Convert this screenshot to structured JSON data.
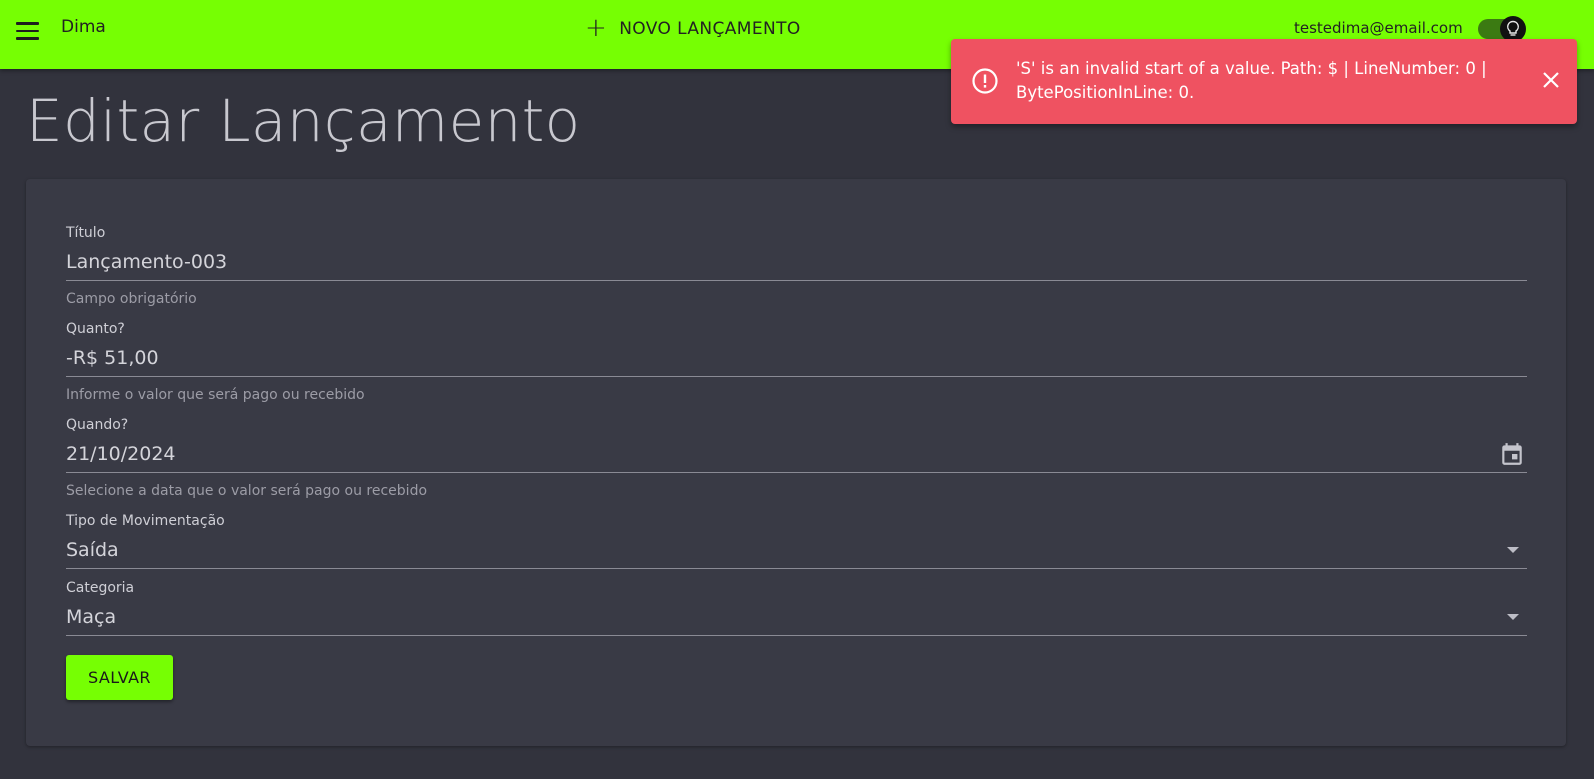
{
  "appbar": {
    "brand": "Dima",
    "new_button_label": "NOVO LANÇAMENTO",
    "user_email": "testedima@email.com"
  },
  "page": {
    "title": "Editar Lançamento"
  },
  "form": {
    "titulo": {
      "label": "Título",
      "value": "Lançamento-003",
      "help": "Campo obrigatório"
    },
    "quanto": {
      "label": "Quanto?",
      "value": "-R$ 51,00",
      "help": "Informe o valor que será pago ou recebido"
    },
    "quando": {
      "label": "Quando?",
      "value": "21/10/2024",
      "help": "Selecione a data que o valor será pago ou recebido"
    },
    "tipo": {
      "label": "Tipo de Movimentação",
      "value": "Saída"
    },
    "categoria": {
      "label": "Categoria",
      "value": "Maça"
    },
    "save_label": "SALVAR"
  },
  "toast": {
    "message": "'S' is an invalid start of a value. Path: $ | LineNumber: 0 | BytePositionInLine: 0."
  },
  "colors": {
    "accent": "#76ff03",
    "background": "#32333d",
    "card": "#393a45",
    "error": "#ef5261"
  },
  "icons": [
    "menu-icon",
    "plus-icon",
    "lightbulb-icon",
    "calendar-icon",
    "dropdown-caret-icon",
    "error-circle-icon",
    "close-icon"
  ]
}
